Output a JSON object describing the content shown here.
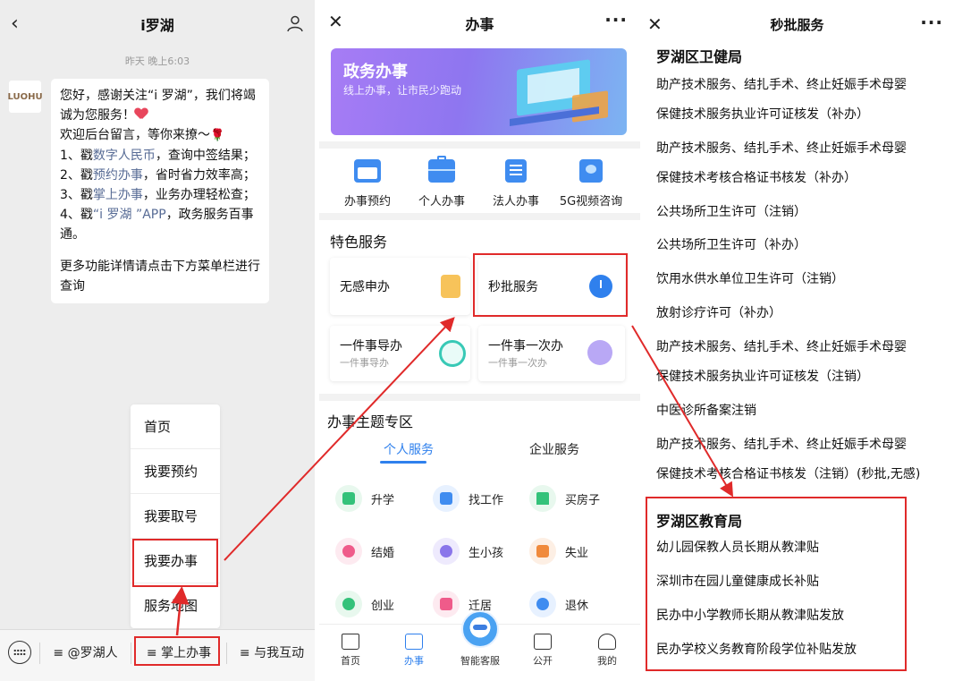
{
  "chat": {
    "title": "i罗湖",
    "timestamp": "昨天 晚上6:03",
    "avatar_text": "LUOHU",
    "message": {
      "line1": "您好，感谢关注“i 罗湖”，我们将竭诚为您服务！",
      "line2": "欢迎后台留言，等你来撩～",
      "item1_pre": "1、戳",
      "item1_link": "数字人民币",
      "item1_post": "，查询中签结果；",
      "item2_pre": "2、戳",
      "item2_link": "预约办事",
      "item2_post": "，省时省力效率高；",
      "item3_pre": "3、戳",
      "item3_link": "掌上办事",
      "item3_post": "，业务办理轻松查；",
      "item4_pre": "4、戳",
      "item4_link": "“i 罗湖 ”APP",
      "item4_post": "，政务服务百事通。",
      "footer": "更多功能详情请点击下方菜单栏进行查询"
    },
    "popup_menu": [
      "首页",
      "我要预约",
      "我要取号",
      "我要办事",
      "服务地图"
    ],
    "bottom_tabs": [
      "≡ @罗湖人",
      "≡ 掌上办事",
      "≡ 与我互动"
    ]
  },
  "banshi": {
    "title": "办事",
    "more": "···",
    "banner_title": "政务办事",
    "banner_subtitle": "线上办事，让市民少跑动",
    "quick_icons": [
      "办事预约",
      "个人办事",
      "法人办事",
      "5G视频咨询"
    ],
    "featured_title": "特色服务",
    "featured_cards": [
      {
        "title": "无感申办",
        "subtitle": ""
      },
      {
        "title": "秒批服务",
        "subtitle": ""
      },
      {
        "title": "一件事导办",
        "subtitle": "一件事导办"
      },
      {
        "title": "一件事一次办",
        "subtitle": "一件事一次办"
      }
    ],
    "theme_title": "办事主题专区",
    "theme_tabs": [
      "个人服务",
      "企业服务"
    ],
    "theme_items": [
      "升学",
      "找工作",
      "买房子",
      "结婚",
      "生小孩",
      "失业",
      "创业",
      "迁居",
      "退休"
    ],
    "nav": [
      "首页",
      "办事",
      "智能客服",
      "公开",
      "我的"
    ]
  },
  "miaopi": {
    "title": "秒批服务",
    "more": "···",
    "section1": "罗湖区卫健局",
    "items1": [
      "助产技术服务、结扎手术、终止妊娠手术母婴",
      "保健技术服务执业许可证核发（补办）",
      "助产技术服务、结扎手术、终止妊娠手术母婴",
      "保健技术考核合格证书核发（补办）",
      "公共场所卫生许可（注销）",
      "公共场所卫生许可（补办）",
      "饮用水供水单位卫生许可（注销）",
      "放射诊疗许可（补办）",
      "助产技术服务、结扎手术、终止妊娠手术母婴",
      "保健技术服务执业许可证核发（注销）",
      "中医诊所备案注销",
      "助产技术服务、结扎手术、终止妊娠手术母婴",
      "保健技术考核合格证书核发（注销）(秒批,无感)"
    ],
    "section2": "罗湖区教育局",
    "items2": [
      "幼儿园保教人员长期从教津贴",
      "深圳市在园儿童健康成长补贴",
      "民办中小学教师长期从教津贴发放",
      "民办学校义务教育阶段学位补贴发放"
    ]
  },
  "colors": {
    "annotation_red": "#e02a2a",
    "accent_blue": "#2f80ed",
    "link_blue": "#576b95"
  }
}
